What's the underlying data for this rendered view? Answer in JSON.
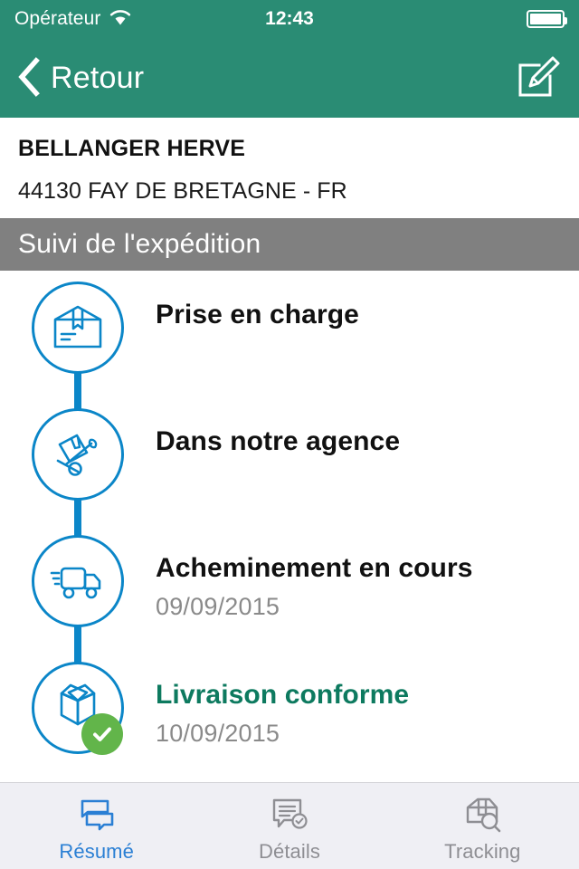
{
  "status_bar": {
    "carrier": "Opérateur",
    "wifi_icon": "wifi-icon",
    "time": "12:43",
    "battery_icon": "battery-full-icon"
  },
  "nav_bar": {
    "back_icon": "chevron-left-icon",
    "back_label": "Retour",
    "compose_icon": "compose-pencil-icon",
    "background_color": "#2a8c74"
  },
  "recipient": {
    "name": "BELLANGER HERVE",
    "address": "44130 FAY DE BRETAGNE - FR"
  },
  "section": {
    "title": "Suivi de l'expédition",
    "background_color": "#808080"
  },
  "timeline": {
    "accent_color": "#0b86c8",
    "done_color": "#0d7a5f",
    "badge_color": "#62b54a",
    "steps": [
      {
        "icon": "package-box-icon",
        "label": "Prise en charge",
        "date": "",
        "state": "pending",
        "badge": ""
      },
      {
        "icon": "hand-truck-icon",
        "label": "Dans notre agence",
        "date": "",
        "state": "pending",
        "badge": ""
      },
      {
        "icon": "delivery-truck-icon",
        "label": "Acheminement en cours",
        "date": "09/09/2015",
        "state": "pending",
        "badge": ""
      },
      {
        "icon": "open-box-icon",
        "label": "Livraison conforme",
        "date": "10/09/2015",
        "state": "done",
        "badge": "check-badge-icon"
      }
    ]
  },
  "tab_bar": {
    "active_color": "#2a7fd4",
    "inactive_color": "#8e8e93",
    "tabs": [
      {
        "icon": "speech-bubbles-icon",
        "label": "Résumé",
        "active": true
      },
      {
        "icon": "document-check-icon",
        "label": "Détails",
        "active": false
      },
      {
        "icon": "package-search-icon",
        "label": "Tracking",
        "active": false
      }
    ]
  }
}
